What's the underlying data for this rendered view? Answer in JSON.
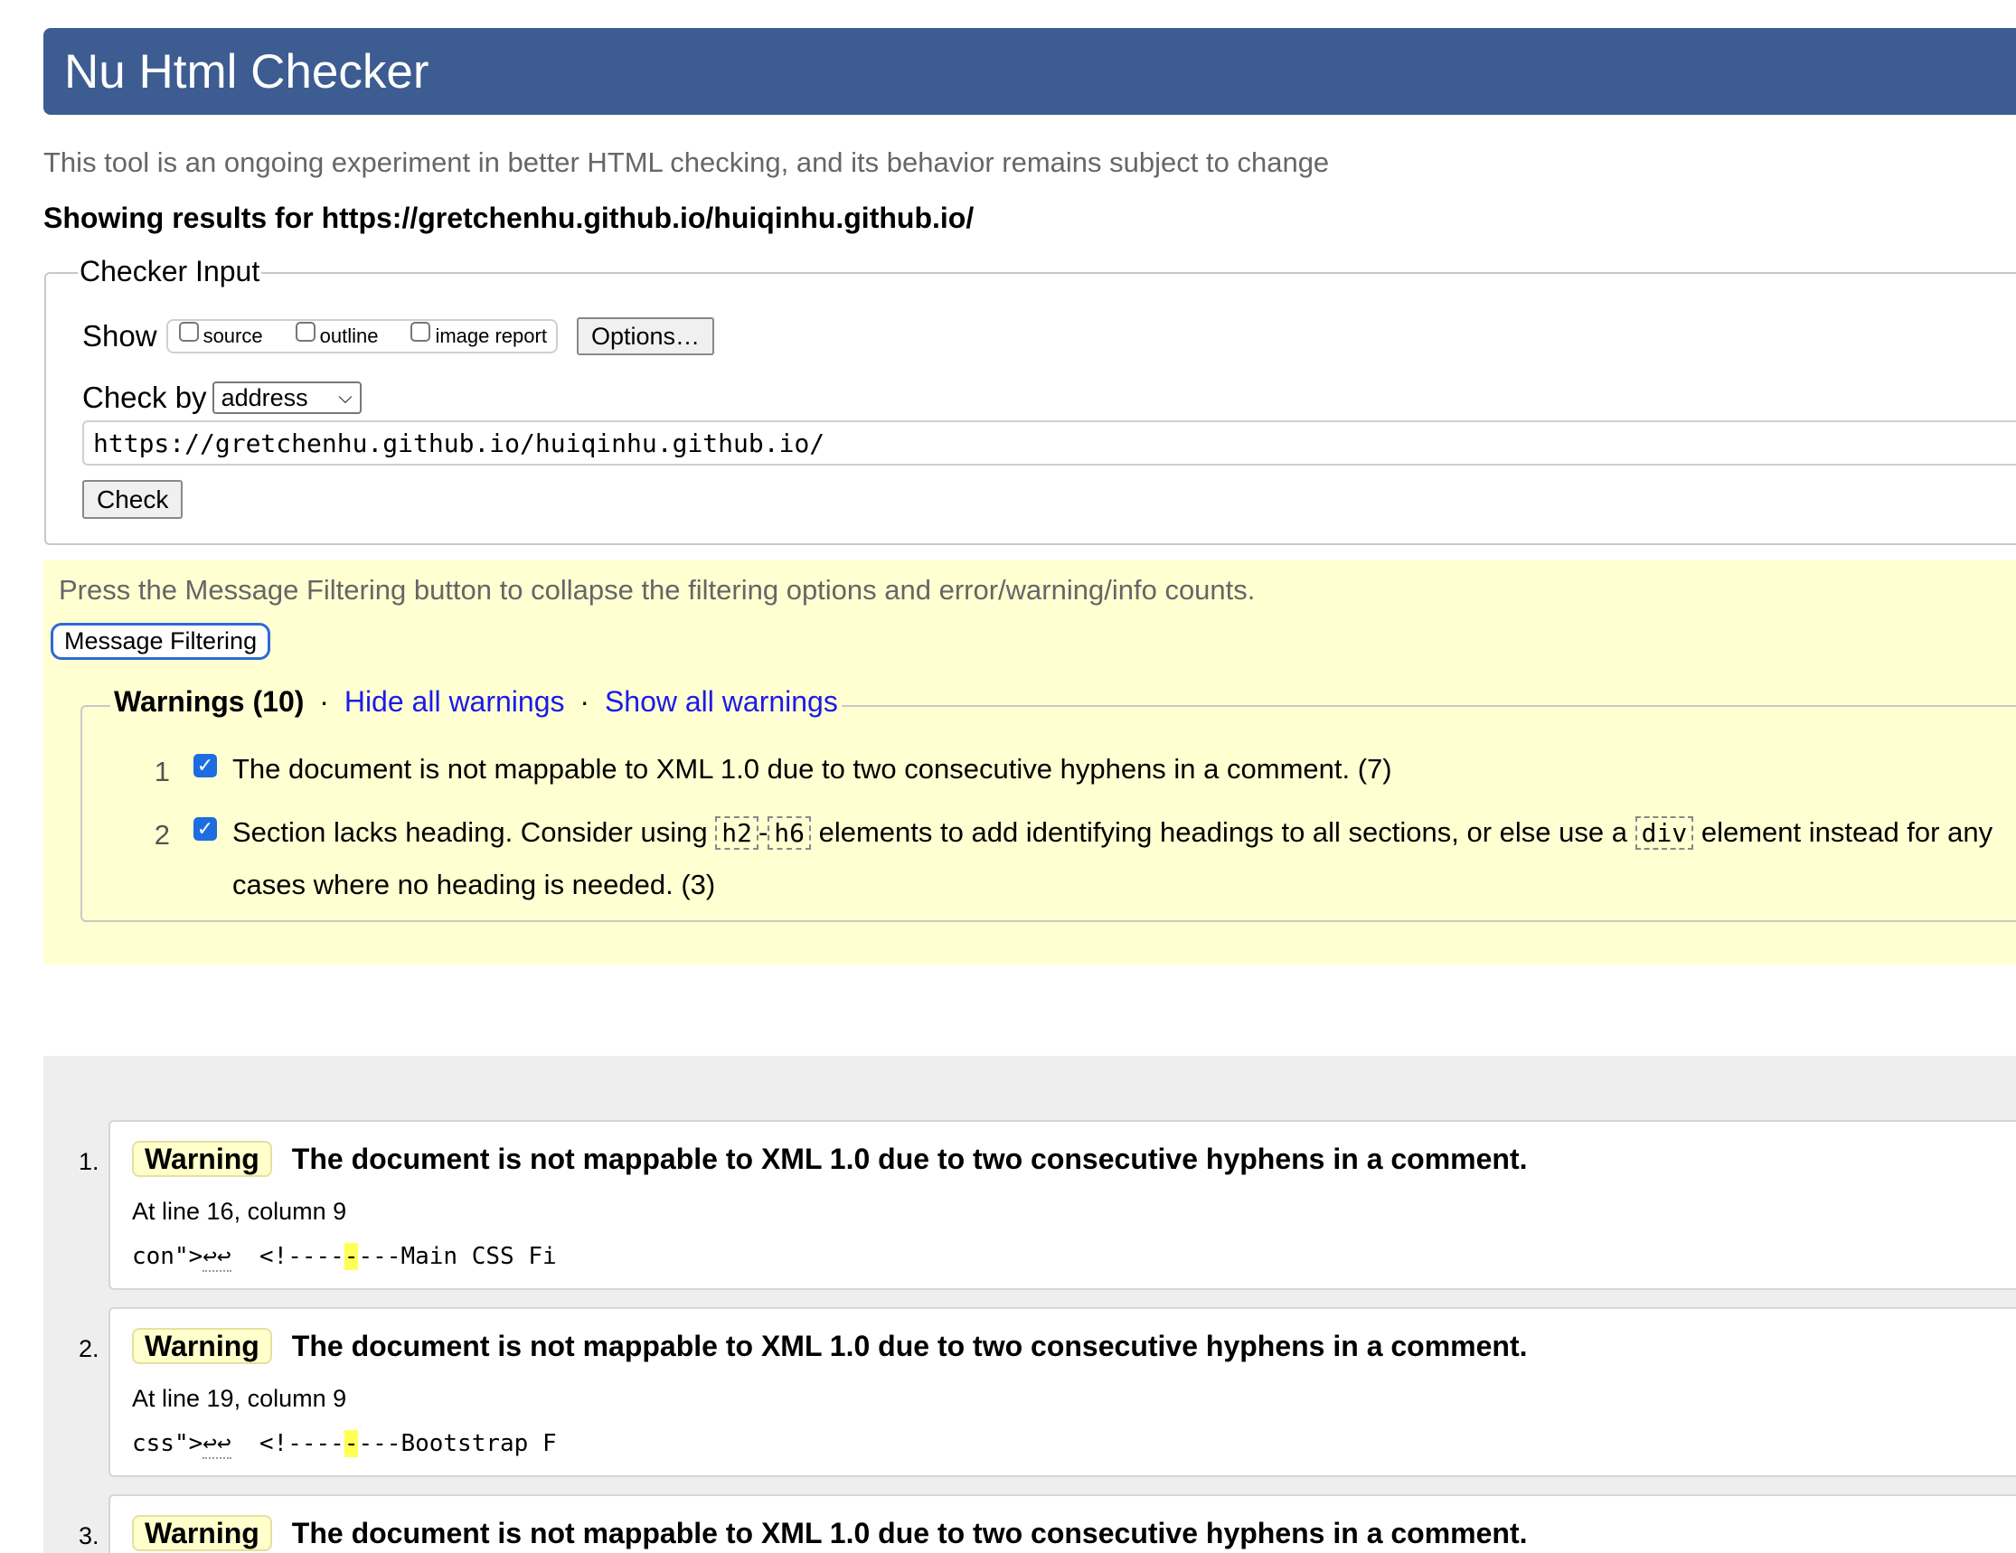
{
  "header": {
    "title": "Nu Html Checker"
  },
  "tagline": "This tool is an ongoing experiment in better HTML checking, and its behavior remains subject to change",
  "showing": "Showing results for https://gretchenhu.github.io/huiqinhu.github.io/",
  "checker": {
    "legend": "Checker Input",
    "show_label": "Show",
    "checkboxes": [
      "source",
      "outline",
      "image report"
    ],
    "options_label": "Options…",
    "checkby_label": "Check by",
    "checkby_value": "address",
    "url_value": "https://gretchenhu.github.io/huiqinhu.github.io/",
    "check_label": "Check"
  },
  "filtering": {
    "note": "Press the Message Filtering button to collapse the filtering options and error/warning/info counts.",
    "button_label": "Message Filtering",
    "legend_title": "Warnings (10)",
    "sep": "·",
    "hide_all": "Hide all warnings",
    "show_all": "Show all warnings",
    "items": [
      {
        "num": "1",
        "text": "The document is not mappable to XML 1.0 due to two consecutive hyphens in a comment. (7)"
      },
      {
        "num": "2",
        "text_a": "Section lacks heading. Consider using",
        "code_a": "h2",
        "dash": "-",
        "code_b": "h6",
        "text_b": "elements to add identifying headings to all sections, or else use a",
        "code_c": "div",
        "text_c": "element instead for any",
        "text_d": "cases where no heading is needed. (3)"
      }
    ]
  },
  "messages": [
    {
      "num": "1.",
      "type": "Warning",
      "title": "The document is not mappable to XML 1.0 due to two consecutive hyphens in a comment.",
      "location": "At line 16, column 9",
      "ext_pre": "con\">",
      "ext_arrows": "↩↩",
      "ext_mid": "  <!----",
      "ext_hl": "-",
      "ext_post": "---Main CSS Fi"
    },
    {
      "num": "2.",
      "type": "Warning",
      "title": "The document is not mappable to XML 1.0 due to two consecutive hyphens in a comment.",
      "location": "At line 19, column 9",
      "ext_pre": "css\">",
      "ext_arrows": "↩↩",
      "ext_mid": "  <!----",
      "ext_hl": "-",
      "ext_post": "---Bootstrap F"
    },
    {
      "num": "3.",
      "type": "Warning",
      "title": "The document is not mappable to XML 1.0 due to two consecutive hyphens in a comment."
    }
  ]
}
